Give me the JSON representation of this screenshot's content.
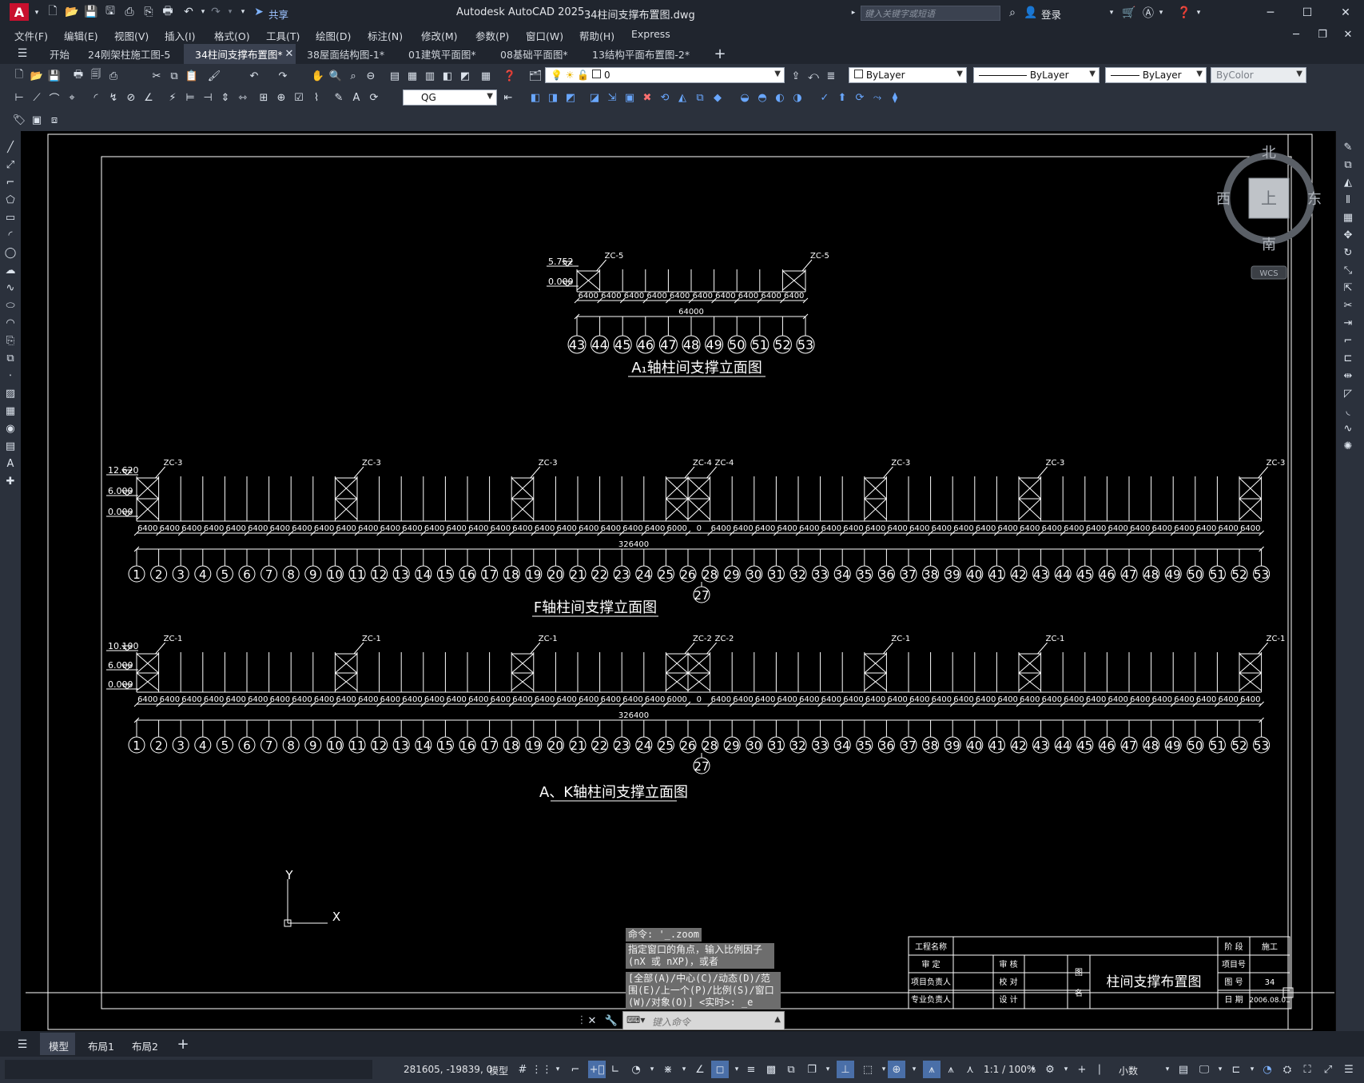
{
  "app": {
    "name": "Autodesk AutoCAD 2025",
    "file": "34柱间支撑布置图.dwg",
    "logo": "A"
  },
  "quick_access": {
    "share_label": "共享"
  },
  "search": {
    "placeholder": "键入关键字或短语"
  },
  "account": {
    "login_label": "登录"
  },
  "menu": [
    "文件(F)",
    "编辑(E)",
    "视图(V)",
    "插入(I)",
    "格式(O)",
    "工具(T)",
    "绘图(D)",
    "标注(N)",
    "修改(M)",
    "参数(P)",
    "窗口(W)",
    "帮助(H)",
    "Express"
  ],
  "tabs": [
    "开始",
    "24刚架柱施工图-5",
    "34柱间支撑布置图*",
    "38屋面结构图-1*",
    "01建筑平面图*",
    "08基础平面图*",
    "13结构平面布置图-2*"
  ],
  "properties": {
    "layer": "0",
    "color": "ByLayer",
    "linetype": "ByLayer",
    "lineweight": "ByLayer",
    "plotstyle": "ByColor",
    "textstyle": "QG"
  },
  "viewcube": {
    "north": "北",
    "south": "南",
    "east": "东",
    "west": "西",
    "top": "上",
    "wcs": "WCS"
  },
  "drawing": {
    "a1": {
      "title": "A₁轴柱间支撑立面图",
      "elev_top": "5.752",
      "elev_base": "0.000",
      "brace": "ZC-5",
      "span": "6400",
      "total": "64000",
      "axes": [
        "43",
        "44",
        "45",
        "46",
        "47",
        "48",
        "49",
        "50",
        "51",
        "52",
        "53"
      ]
    },
    "f": {
      "title": "F轴柱间支撑立面图",
      "elev_top": "12.620",
      "elev_mid": "6.000",
      "elev_base": "0.000",
      "brace_main": "ZC-3",
      "brace_mid": "ZC-4",
      "total": "326400"
    },
    "ak": {
      "title": "A、K轴柱间支撑立面图",
      "elev_top": "10.100",
      "elev_mid": "6.000",
      "elev_base": "0.000",
      "brace_main": "ZC-1",
      "brace_mid": "ZC-2",
      "total": "326400"
    },
    "spans": {
      "normal": "6400",
      "short": "6000",
      "zero": "0"
    },
    "ucs": {
      "x": "X",
      "y": "Y"
    }
  },
  "title_block": {
    "project_name_label": "工程名称",
    "review_label": "审 定",
    "audit_label": "审 核",
    "project_lead_label": "项目负责人",
    "check_label": "校 对",
    "discipline_lead_label": "专业负责人",
    "design_label": "设 计",
    "drawing_label_1": "图",
    "drawing_label_2": "名",
    "drawing_name": "柱间支撑布置图",
    "stage_label": "阶 段",
    "stage_value": "施工",
    "project_no_label": "项目号",
    "sheet_no_label": "图 号",
    "sheet_no_value": "34",
    "date_label": "日 期",
    "date_value": "2006.08.01"
  },
  "command": {
    "history": [
      "命令: '_.zoom",
      "指定窗口的角点，输入比例因子 (nX 或 nXP)，或者",
      "[全部(A)/中心(C)/动态(D)/范围(E)/上一个(P)/比例(S)/窗口(W)/对象(O)] <实时>: _e"
    ],
    "placeholder": "键入命令"
  },
  "layouts": [
    "模型",
    "布局1",
    "布局2"
  ],
  "status": {
    "coords": "281605, -19839, 0",
    "space": "模型",
    "scale": "1:1 / 100%",
    "units": "小数"
  }
}
